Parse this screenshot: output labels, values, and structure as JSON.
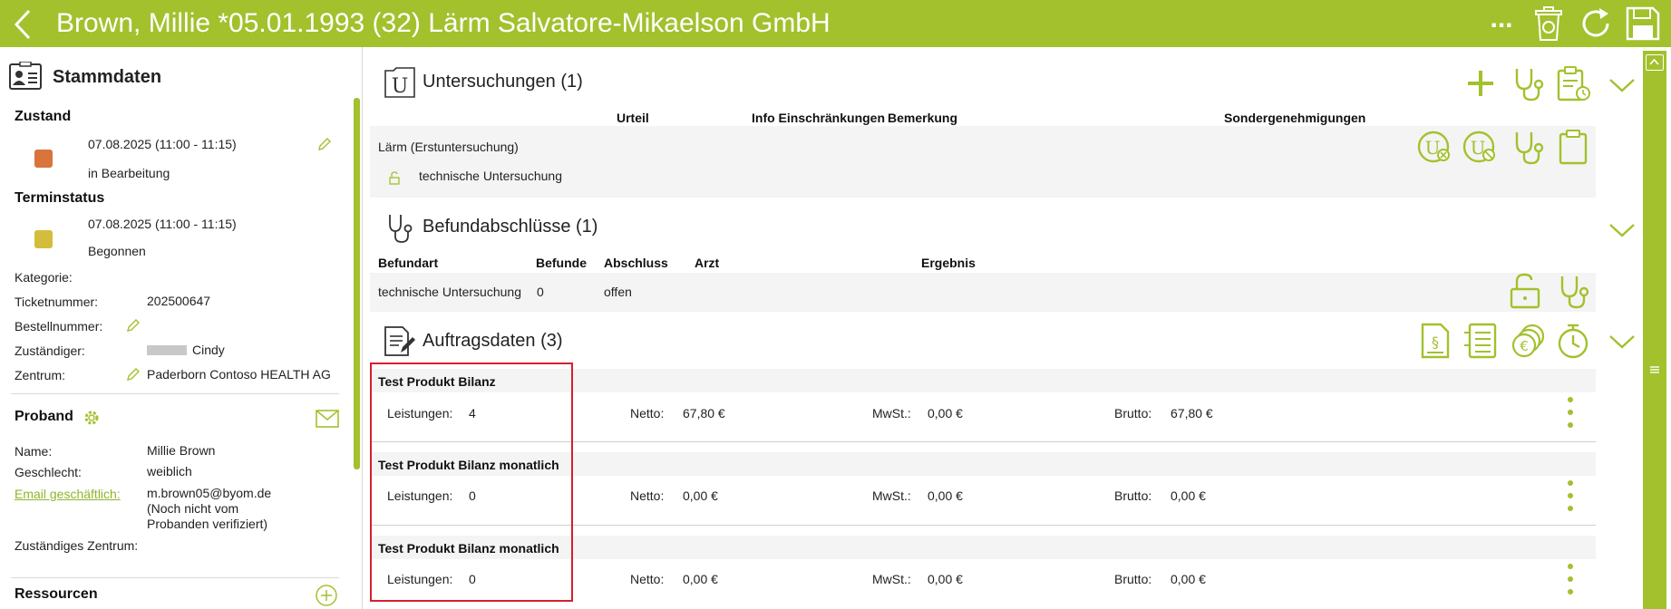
{
  "header": {
    "title": "Brown, Millie *05.01.1993 (32) Lärm Salvatore-Mikaelson GmbH",
    "more_label": "..."
  },
  "stammdaten": {
    "title": "Stammdaten",
    "zustand_label": "Zustand",
    "zustand_date": "07.08.2025 (11:00 - 11:15)",
    "zustand_status": "in Bearbeitung",
    "zustand_color": "#d8743c",
    "terminstatus_label": "Terminstatus",
    "terminstatus_date": "07.08.2025 (11:00 - 11:15)",
    "terminstatus_status": "Begonnen",
    "terminstatus_color": "#d4bd3c",
    "kategorie_label": "Kategorie:",
    "ticket_label": "Ticketnummer:",
    "ticket_value": "202500647",
    "bestell_label": "Bestellnummer:",
    "zustaendiger_label": "Zuständiger:",
    "zustaendiger_value": "Cindy",
    "zentrum_label": "Zentrum:",
    "zentrum_value": "Paderborn Contoso HEALTH AG"
  },
  "proband": {
    "title": "Proband",
    "name_label": "Name:",
    "name_value": "Millie Brown",
    "geschlecht_label": "Geschlecht:",
    "geschlecht_value": "weiblich",
    "email_label": "Email geschäftlich:",
    "email_value": "m.brown05@byom.de",
    "email_note1": "(Noch nicht vom",
    "email_note2": "Probanden verifiziert)",
    "zentrum_label": "Zuständiges Zentrum:"
  },
  "ressourcen": {
    "title": "Ressourcen"
  },
  "untersuchungen": {
    "title": "Untersuchungen (1)",
    "col_urteil": "Urteil",
    "col_info": "Info Einschränkungen",
    "col_bemerkung": "Bemerkung",
    "col_sonder": "Sondergenehmigungen",
    "row_title": "Lärm (Erstuntersuchung)",
    "row_sub": "technische Untersuchung"
  },
  "befund": {
    "title": "Befundabschlüsse (1)",
    "col_befundart": "Befundart",
    "col_befunde": "Befunde",
    "col_abschluss": "Abschluss",
    "col_arzt": "Arzt",
    "col_ergebnis": "Ergebnis",
    "row_befundart": "technische Untersuchung",
    "row_befunde": "0",
    "row_abschluss": "offen"
  },
  "auftrag": {
    "title": "Auftragsdaten (3)",
    "leistungen_label": "Leistungen:",
    "netto_label": "Netto:",
    "mwst_label": "MwSt.:",
    "brutto_label": "Brutto:",
    "orders": [
      {
        "title": "Test Produkt Bilanz",
        "leistungen": "4",
        "netto": "67,80 €",
        "mwst": "0,00 €",
        "brutto": "67,80 €"
      },
      {
        "title": "Test Produkt Bilanz monatlich",
        "leistungen": "0",
        "netto": "0,00 €",
        "mwst": "0,00 €",
        "brutto": "0,00 €"
      },
      {
        "title": "Test Produkt Bilanz monatlich",
        "leistungen": "0",
        "netto": "0,00 €",
        "mwst": "0,00 €",
        "brutto": "0,00 €"
      }
    ]
  },
  "colors": {
    "brand": "#a2c12d",
    "highlight": "#d5202f"
  }
}
